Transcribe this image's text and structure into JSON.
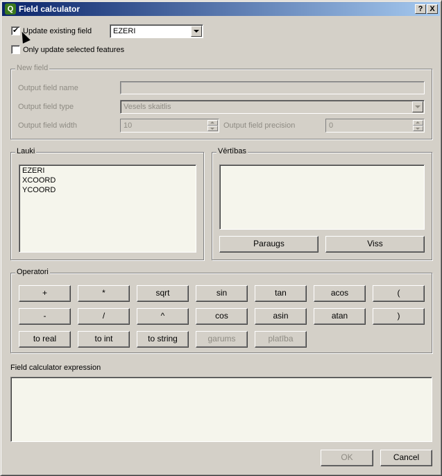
{
  "titlebar": {
    "title": "Field calculator",
    "help": "?",
    "close": "X"
  },
  "update_existing": {
    "label": "Update existing field",
    "checked": true,
    "field_value": "EZERI"
  },
  "only_selected": {
    "label": "Only update selected features"
  },
  "new_field": {
    "legend": "New field",
    "name_label": "Output field name",
    "type_label": "Output field type",
    "type_value": "Vesels skaitlis",
    "width_label": "Output field width",
    "width_value": "10",
    "precision_label": "Output field precision",
    "precision_value": "0"
  },
  "fields": {
    "legend": "Lauki",
    "items": [
      "EZERI",
      "XCOORD",
      "YCOORD"
    ]
  },
  "values": {
    "legend": "Vērtības",
    "sample_button": "Paraugs",
    "all_button": "Viss"
  },
  "operators": {
    "legend": "Operatori",
    "row1": [
      "+",
      "*",
      "sqrt",
      "sin",
      "tan",
      "acos",
      "("
    ],
    "row2": [
      "-",
      "/",
      "^",
      "cos",
      "asin",
      "atan",
      ")"
    ],
    "row3": [
      "to real",
      "to int",
      "to string",
      "garums",
      "platība"
    ]
  },
  "expression": {
    "label": "Field calculator expression",
    "value": ""
  },
  "dialog": {
    "ok": "OK",
    "cancel": "Cancel"
  }
}
